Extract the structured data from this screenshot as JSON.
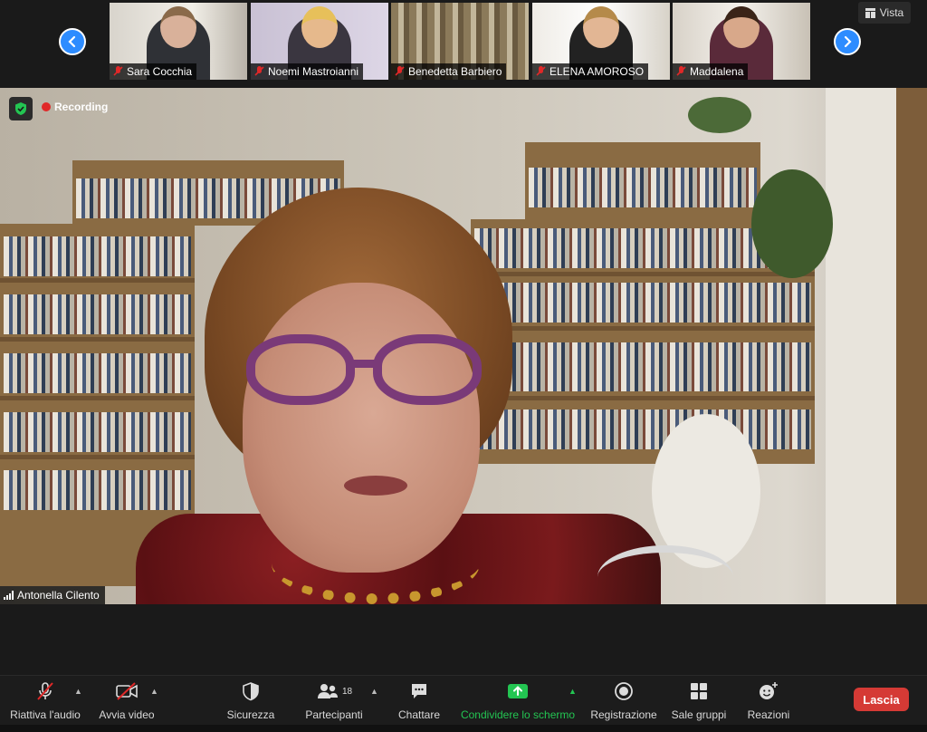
{
  "gallery": {
    "participants": [
      {
        "name": "Sara Cocchia",
        "muted": true
      },
      {
        "name": "Noemi Mastroianni",
        "muted": true
      },
      {
        "name": "Benedetta Barbiero",
        "muted": true
      },
      {
        "name": "ELENA AMOROSO",
        "muted": true
      },
      {
        "name": "Maddalena",
        "muted": true
      }
    ],
    "view_label": "Vista"
  },
  "main": {
    "recording_label": "Recording",
    "speaker_name": "Antonella Cilento"
  },
  "toolbar": {
    "unmute_label": "Riattiva l'audio",
    "start_video_label": "Avvia video",
    "security_label": "Sicurezza",
    "participants_label": "Partecipanti",
    "participants_count": "18",
    "chat_label": "Chattare",
    "share_label": "Condividere lo schermo",
    "record_label": "Registrazione",
    "breakout_label": "Sale gruppi",
    "reactions_label": "Reazioni",
    "leave_label": "Lascia"
  },
  "colors": {
    "accent_blue": "#2d8cff",
    "share_green": "#23c552",
    "leave_red": "#d53a35",
    "mute_red": "#e02828"
  }
}
